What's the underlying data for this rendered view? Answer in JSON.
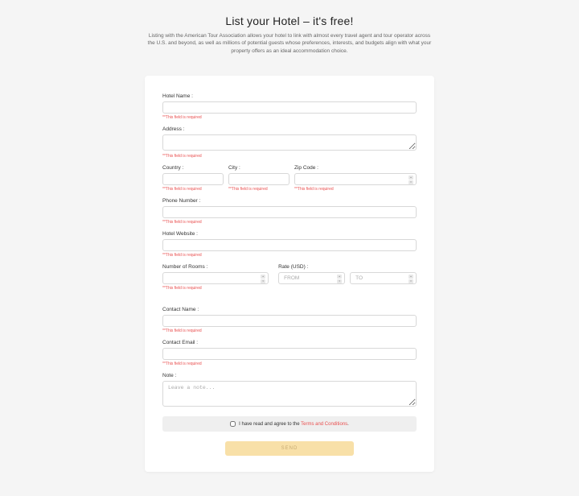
{
  "header": {
    "title": "List your Hotel – it's free!",
    "subtitle": "Listing with the American Tour Association allows your hotel to link with almost every travel agent and tour operator across the U.S. and beyond, as well as millions of potential guests whose preferences, interests, and budgets align with what your property offers as an ideal accommodation choice."
  },
  "labels": {
    "hotel_name": "Hotel Name :",
    "address": "Address :",
    "country": "Country :",
    "city": "City :",
    "zip": "Zip Code :",
    "phone": "Phone Number :",
    "website": "Hotel Website :",
    "rooms": "Number of Rooms :",
    "rate": "Rate (USD) :",
    "contact_name": "Contact Name :",
    "contact_email": "Contact Email :",
    "note": "Note :"
  },
  "placeholders": {
    "rate_from": "FROM",
    "rate_to": "TO",
    "note": "Leave a note..."
  },
  "errors": {
    "required": "**This field is required"
  },
  "agree": {
    "text_prefix": "I have read and agree to the ",
    "link_text": "Terms and Conditions",
    "text_suffix": "."
  },
  "actions": {
    "send": "SEND"
  }
}
